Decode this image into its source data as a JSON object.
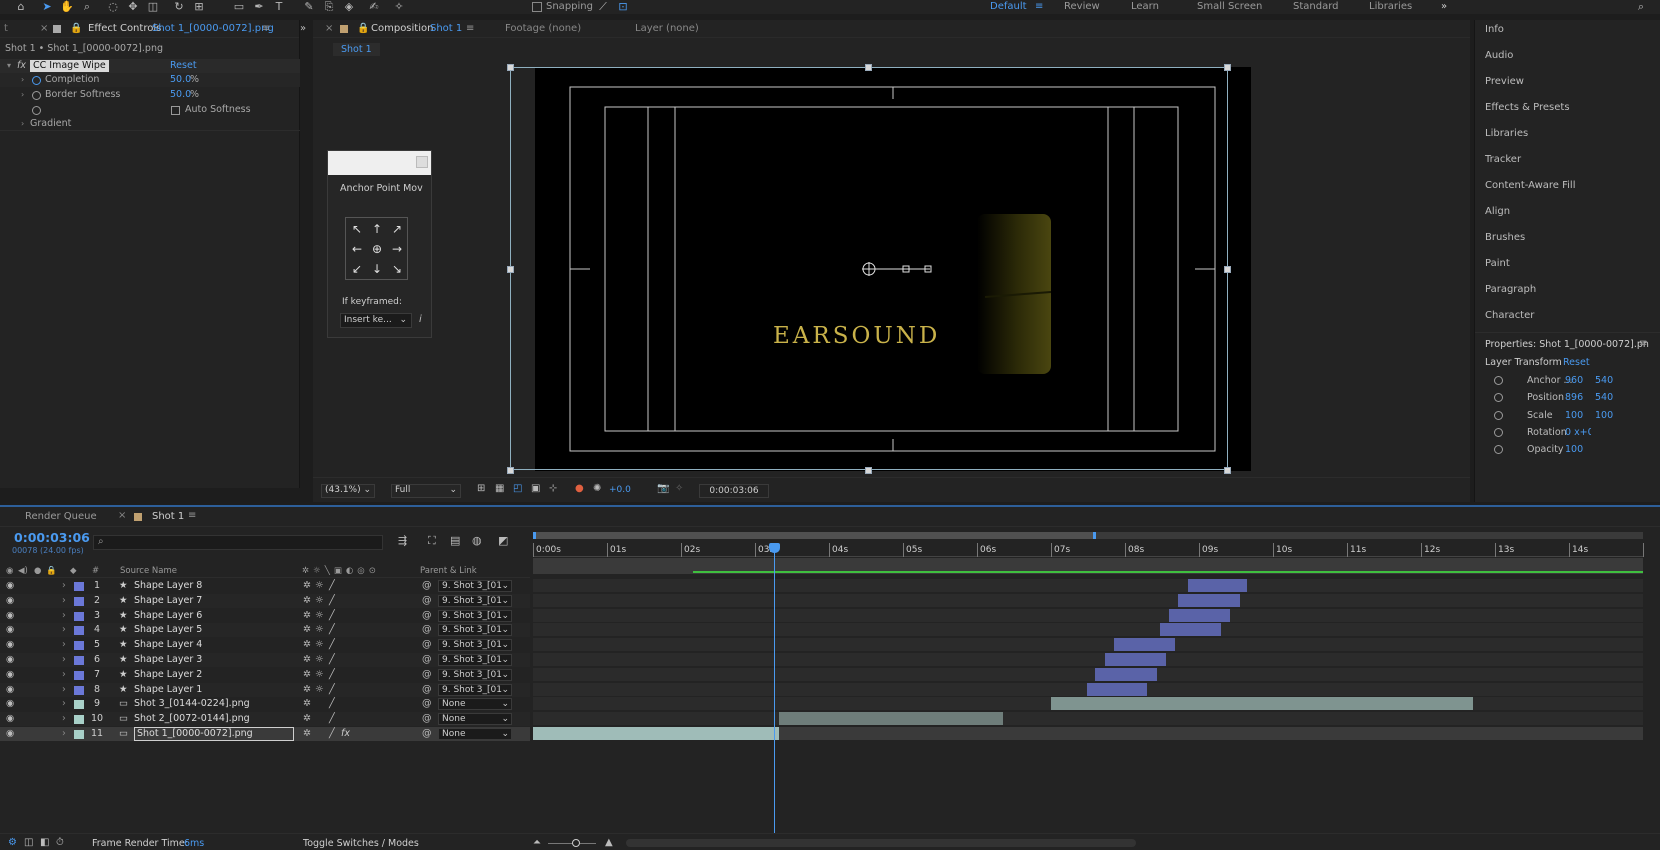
{
  "toolbar": {
    "snapping_label": "Snapping",
    "workspaces": [
      "Default",
      "Review",
      "Learn",
      "Small Screen",
      "Standard",
      "Libraries"
    ],
    "active_workspace": "Default",
    "overflow": "»"
  },
  "effect_controls": {
    "tab_label": "Effect Controls",
    "tab_layer": "Shot 1_[0000-0072].png",
    "breadcrumb": "Shot 1 • Shot 1_[0000-0072].png",
    "effect_name": "CC Image Wipe",
    "reset_label": "Reset",
    "completion_label": "Completion",
    "completion_value": "50.0",
    "border_softness_label": "Border Softness",
    "border_softness_value": "50.0",
    "percent": "%",
    "auto_softness_label": "Auto Softness",
    "gradient_label": "Gradient",
    "fx": "fx"
  },
  "composition": {
    "tab_label": "Composition",
    "tab_name": "Shot 1",
    "footage_label": "Footage (none)",
    "layer_label": "Layer (none)",
    "subtab": "Shot 1",
    "zoom": "(43.1%)",
    "resolution": "Full",
    "exposure": "+0.0",
    "timecode": "0:00:03:06",
    "text_overlay": "EARSOUND"
  },
  "anchor_dialog": {
    "title": "Anchor Point Mov",
    "keyframed_label": "If keyframed:",
    "keyframed_value": "Insert ke...",
    "info": "i",
    "arrows": [
      "↖",
      "↑",
      "↗",
      "←",
      "⊕",
      "→",
      "↙",
      "↓",
      "↘"
    ]
  },
  "right_panel": {
    "items": [
      "Info",
      "Audio",
      "Preview",
      "Effects & Presets",
      "Libraries",
      "Tracker",
      "Content-Aware Fill",
      "Align",
      "Brushes",
      "Paint",
      "Paragraph",
      "Character"
    ],
    "properties_title": "Properties: Shot 1_[0000-0072].pn",
    "layer_transform": "Layer Transform",
    "reset": "Reset",
    "props": [
      {
        "label": "Anchor ...",
        "v1": "960",
        "v2": "540"
      },
      {
        "label": "Position",
        "v1": "896",
        "v2": "540"
      },
      {
        "label": "Scale",
        "v1": "100",
        "v2": "100"
      },
      {
        "label": "Rotation",
        "v1": "0 x+0 °",
        "v2": ""
      },
      {
        "label": "Opacity",
        "v1": "100",
        "v2": ""
      }
    ]
  },
  "timeline": {
    "render_queue_tab": "Render Queue",
    "shot_tab": "Shot 1",
    "timecode": "0:00:03:06",
    "frame_info": "00078 (24.00 fps)",
    "search_placeholder": "",
    "col_hash": "#",
    "col_source": "Source Name",
    "col_parent": "Parent & Link",
    "ruler": [
      "0:00s",
      "01s",
      "02s",
      "03s",
      "04s",
      "05s",
      "06s",
      "07s",
      "08s",
      "09s",
      "10s",
      "11s",
      "12s",
      "13s",
      "14s",
      "15s"
    ],
    "layers": [
      {
        "num": "1",
        "name": "Shape Layer 8",
        "parent": "9. Shot 3_[01",
        "color": "#6b78d8",
        "type": "shape",
        "start": 8.85,
        "end": 9.65,
        "bar_color": "#5a63a8"
      },
      {
        "num": "2",
        "name": "Shape Layer 7",
        "parent": "9. Shot 3_[01",
        "color": "#6b78d8",
        "type": "shape",
        "start": 8.72,
        "end": 9.55,
        "bar_color": "#5a63a8"
      },
      {
        "num": "3",
        "name": "Shape Layer 6",
        "parent": "9. Shot 3_[01",
        "color": "#6b78d8",
        "type": "shape",
        "start": 8.6,
        "end": 9.42,
        "bar_color": "#5a63a8"
      },
      {
        "num": "4",
        "name": "Shape Layer 5",
        "parent": "9. Shot 3_[01",
        "color": "#6b78d8",
        "type": "shape",
        "start": 8.47,
        "end": 9.3,
        "bar_color": "#5a63a8"
      },
      {
        "num": "5",
        "name": "Shape Layer 4",
        "parent": "9. Shot 3_[01",
        "color": "#6b78d8",
        "type": "shape",
        "start": 7.85,
        "end": 8.67,
        "bar_color": "#5a63a8"
      },
      {
        "num": "6",
        "name": "Shape Layer 3",
        "parent": "9. Shot 3_[01",
        "color": "#6b78d8",
        "type": "shape",
        "start": 7.73,
        "end": 8.55,
        "bar_color": "#5a63a8"
      },
      {
        "num": "7",
        "name": "Shape Layer 2",
        "parent": "9. Shot 3_[01",
        "color": "#6b78d8",
        "type": "shape",
        "start": 7.6,
        "end": 8.43,
        "bar_color": "#5a63a8"
      },
      {
        "num": "8",
        "name": "Shape Layer 1",
        "parent": "9. Shot 3_[01",
        "color": "#6b78d8",
        "type": "shape",
        "start": 7.48,
        "end": 8.3,
        "bar_color": "#5a63a8"
      },
      {
        "num": "9",
        "name": "Shot 3_[0144-0224].png",
        "parent": "None",
        "color": "#a8d0c8",
        "type": "footage",
        "start": 7.0,
        "end": 12.7,
        "bar_color": "#7f9490"
      },
      {
        "num": "10",
        "name": "Shot 2_[0072-0144].png",
        "parent": "None",
        "color": "#a8d0c8",
        "type": "footage",
        "start": 3.33,
        "end": 6.35,
        "bar_color": "#6e7d7a"
      },
      {
        "num": "11",
        "name": "Shot 1_[0000-0072].png",
        "parent": "None",
        "color": "#a8d0c8",
        "type": "footage",
        "start": 0.0,
        "end": 3.33,
        "bar_color": "#9fbcb8",
        "selected": true
      }
    ],
    "fx": "fx",
    "frame_render_label": "Frame Render Time:",
    "frame_render_value": "6ms",
    "toggle_label": "Toggle Switches / Modes"
  },
  "colors": {
    "accent": "#4a9af0",
    "cti": "#4a9af0",
    "work_area": "#3fbf3f",
    "title_text": "#c9b24a"
  }
}
